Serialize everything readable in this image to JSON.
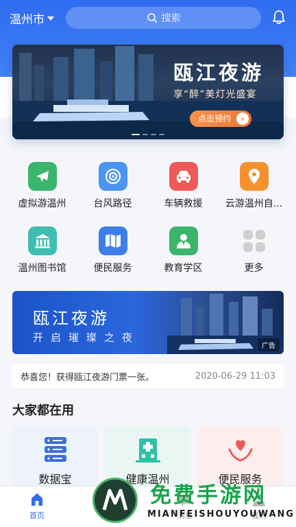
{
  "header": {
    "city": "温州市",
    "search_placeholder": "搜索"
  },
  "banner": {
    "title": "瓯江夜游",
    "subtitle": "享“醉”美灯光盛宴",
    "button": "点击预约"
  },
  "services": [
    {
      "label": "虚拟游温州",
      "icon": "airplane-icon",
      "color": "#3bb56c"
    },
    {
      "label": "台风路径",
      "icon": "typhoon-icon",
      "color": "#4b95f2"
    },
    {
      "label": "车辆救援",
      "icon": "car-icon",
      "color": "#ee5a5a"
    },
    {
      "label": "云游温州自...",
      "icon": "location-pin-icon",
      "color": "#f5922f"
    },
    {
      "label": "温州图书馆",
      "icon": "library-icon",
      "color": "#3fbdb0"
    },
    {
      "label": "便民服务",
      "icon": "map-icon",
      "color": "#3d7ee9"
    },
    {
      "label": "教育学区",
      "icon": "teacher-icon",
      "color": "#3bb56c"
    },
    {
      "label": "更多",
      "icon": "more-grid-icon",
      "color": "#cfcfcf"
    }
  ],
  "ad": {
    "title": "瓯江夜游",
    "subtitle": "开启璀璨之夜",
    "tag": "广告"
  },
  "notice": {
    "message": "恭喜您！获得瓯江夜游门票一张。",
    "date": "2020-06-29 11:03"
  },
  "popular": {
    "title": "大家都在用",
    "items": [
      {
        "label": "数据宝",
        "icon": "database-icon",
        "bg": "#eef2fb"
      },
      {
        "label": "健康温州",
        "icon": "hospital-icon",
        "bg": "#eaf6f3"
      },
      {
        "label": "便民服务",
        "icon": "heart-hands-icon",
        "bg": "#fdeeee"
      }
    ]
  },
  "tabbar": {
    "items": [
      {
        "label": "首页"
      },
      {
        "label": "服务"
      },
      {
        "label": "消息"
      },
      {
        "label": "我的"
      }
    ]
  },
  "watermark": {
    "text": "免费手游网",
    "english": "MIANFEISHOUYOUWANG"
  }
}
